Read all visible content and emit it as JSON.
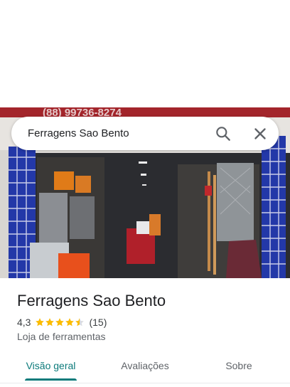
{
  "search": {
    "value": "Ferragens Sao Bento"
  },
  "icons": {
    "search": "search-icon",
    "close": "close-icon",
    "star": "star-icon"
  },
  "place": {
    "name": "Ferragens Sao Bento",
    "rating": "4,3",
    "rating_value": 4.3,
    "review_count": "(15)",
    "category": "Loja de ferramentas",
    "photo_sign_text": "(88) 99736-8274"
  },
  "tabs": [
    {
      "label": "Visão geral",
      "active": true
    },
    {
      "label": "Avaliações",
      "active": false
    },
    {
      "label": "Sobre",
      "active": false
    }
  ],
  "colors": {
    "accent": "#0b7a7a",
    "star": "#fbbc04"
  }
}
